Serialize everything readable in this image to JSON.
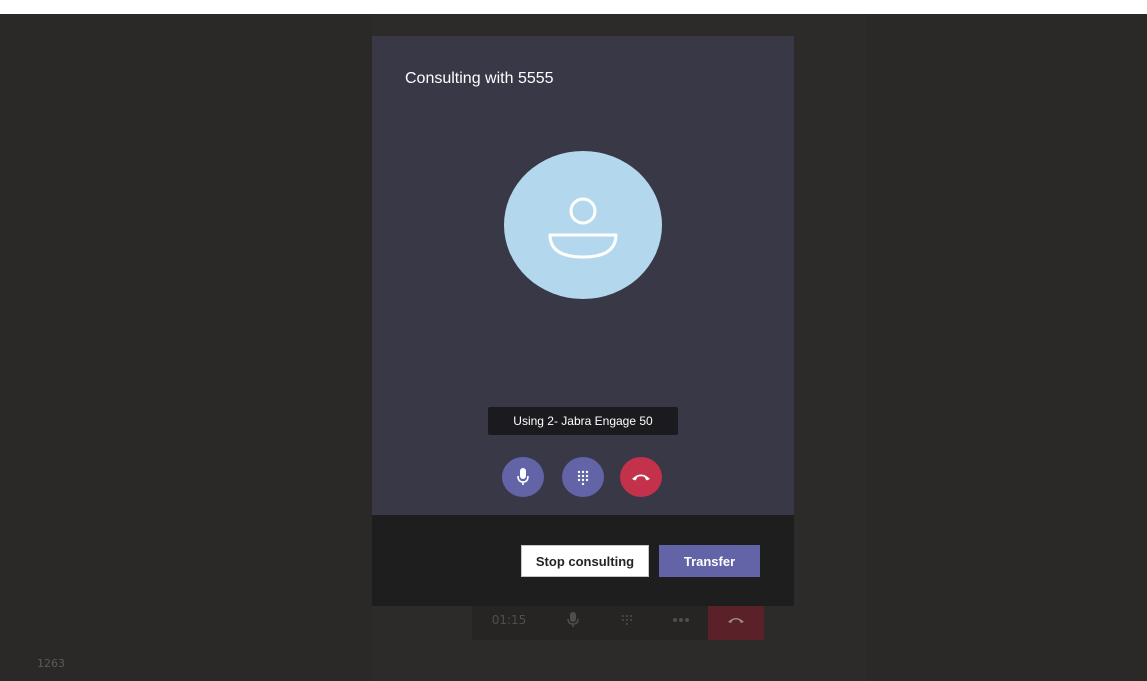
{
  "dialog": {
    "title": "Consulting with 5555",
    "device_tooltip": "Using 2- Jabra Engage 50",
    "controls": [
      {
        "name": "mute",
        "icon": "microphone-icon",
        "color": "#6264a7"
      },
      {
        "name": "dialpad",
        "icon": "dialpad-icon",
        "color": "#6264a7"
      },
      {
        "name": "hang-up",
        "icon": "hang-up-icon",
        "color": "#c4314b"
      }
    ],
    "stop_label": "Stop consulting",
    "transfer_label": "Transfer"
  },
  "background_call": {
    "timer": "01:15",
    "controls": [
      "microphone-icon",
      "dialpad-icon",
      "more-icon",
      "hang-up-icon"
    ]
  },
  "footer_text": "1263",
  "colors": {
    "accent": "#6264a7",
    "danger": "#c4314b",
    "avatar": "#b3d8ee",
    "dialog_bg": "#393846"
  }
}
